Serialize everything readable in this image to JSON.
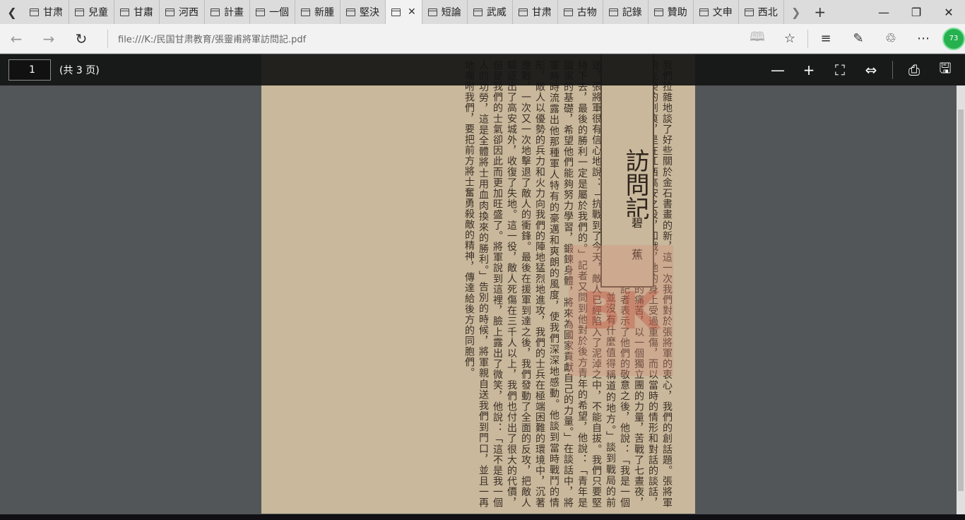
{
  "tabs": [
    {
      "label": "甘肃",
      "active": false
    },
    {
      "label": "兒童",
      "active": false
    },
    {
      "label": "甘肅",
      "active": false
    },
    {
      "label": "河西",
      "active": false
    },
    {
      "label": "計畫",
      "active": false
    },
    {
      "label": "一個",
      "active": false
    },
    {
      "label": "新腫",
      "active": false
    },
    {
      "label": "堅決",
      "active": false
    },
    {
      "label": "",
      "active": true
    },
    {
      "label": "短論",
      "active": false
    },
    {
      "label": "武威",
      "active": false
    },
    {
      "label": "甘肃",
      "active": false
    },
    {
      "label": "古物",
      "active": false
    },
    {
      "label": "記錄",
      "active": false
    },
    {
      "label": "贊助",
      "active": false
    },
    {
      "label": "文申",
      "active": false
    },
    {
      "label": "西北",
      "active": false
    }
  ],
  "address": {
    "url": "file:///K:/民国甘肃教育/張靈甫將軍訪問記.pdf"
  },
  "profile": {
    "badge": "73"
  },
  "pdf_toolbar": {
    "page_number": "1",
    "page_total": "(共 3 页)"
  },
  "document": {
    "title": "訪問記",
    "author": "碧 蕉",
    "watermark": "BK",
    "body": "我們拉雜地談了好些關於金石書畫的新，這一次我們對於張將軍的衷心，我們的創話題。張將軍的光榮的創痕，是在江西高安之役，和戰，他的身上受過重傷，而以當時的情形和對話的談話，在高安城下這一個有名的戰役中，他忍受著極大的痛苦，以一個獨立團的力量，苦戰了七晝夜，終於打破了敵人的包圍。現在他正在山城養傷。記者表示了他們的敬意之後，他說：「我是一個軍人，為國家民族而受傷，是軍人應盡的天職，並沒有什麼值得稱道的地方。」談到戰局的前途，張將軍很有信心地說：「抗戰到了今天，敵人已經陷入了泥淖之中，不能自拔。我們只要堅持下去，最後的勝利一定是屬於我們的。」記者又問到他對於後方青年的希望，他說：「青年是國家的基礎，希望他們能夠努力學習，鍛鍊身體，將來為國家貢獻自己的力量。」在談話中，將軍時時流露出他那種軍人特有的豪邁和爽朗的風度，使我們深深地感動。他談到當時戰鬥的情形，敵人以優勢的兵力和火力向我們的陣地猛烈地進攻，我們的士兵在極端困難的環境中，沉著應戰，一次又一次地擊退了敵人的衝鋒。最後在援軍到達之後，我們發動了全面的反攻，把敵人驅逐出了高安城外，收復了失地。這一役，敵人死傷在三千人以上，我們也付出了很大的代價，但是我們的士氣卻因此而更加旺盛了。將軍說到這裡，臉上露出了微笑，他說：「這不是我一個人的功勞，這是全體將士用血肉換來的勝利。」告別的時候，將軍親自送我們到門口，並且一再地囑咐我們，要把前方將士奮勇殺敵的精神，傳達給後方的同胞們。"
  }
}
